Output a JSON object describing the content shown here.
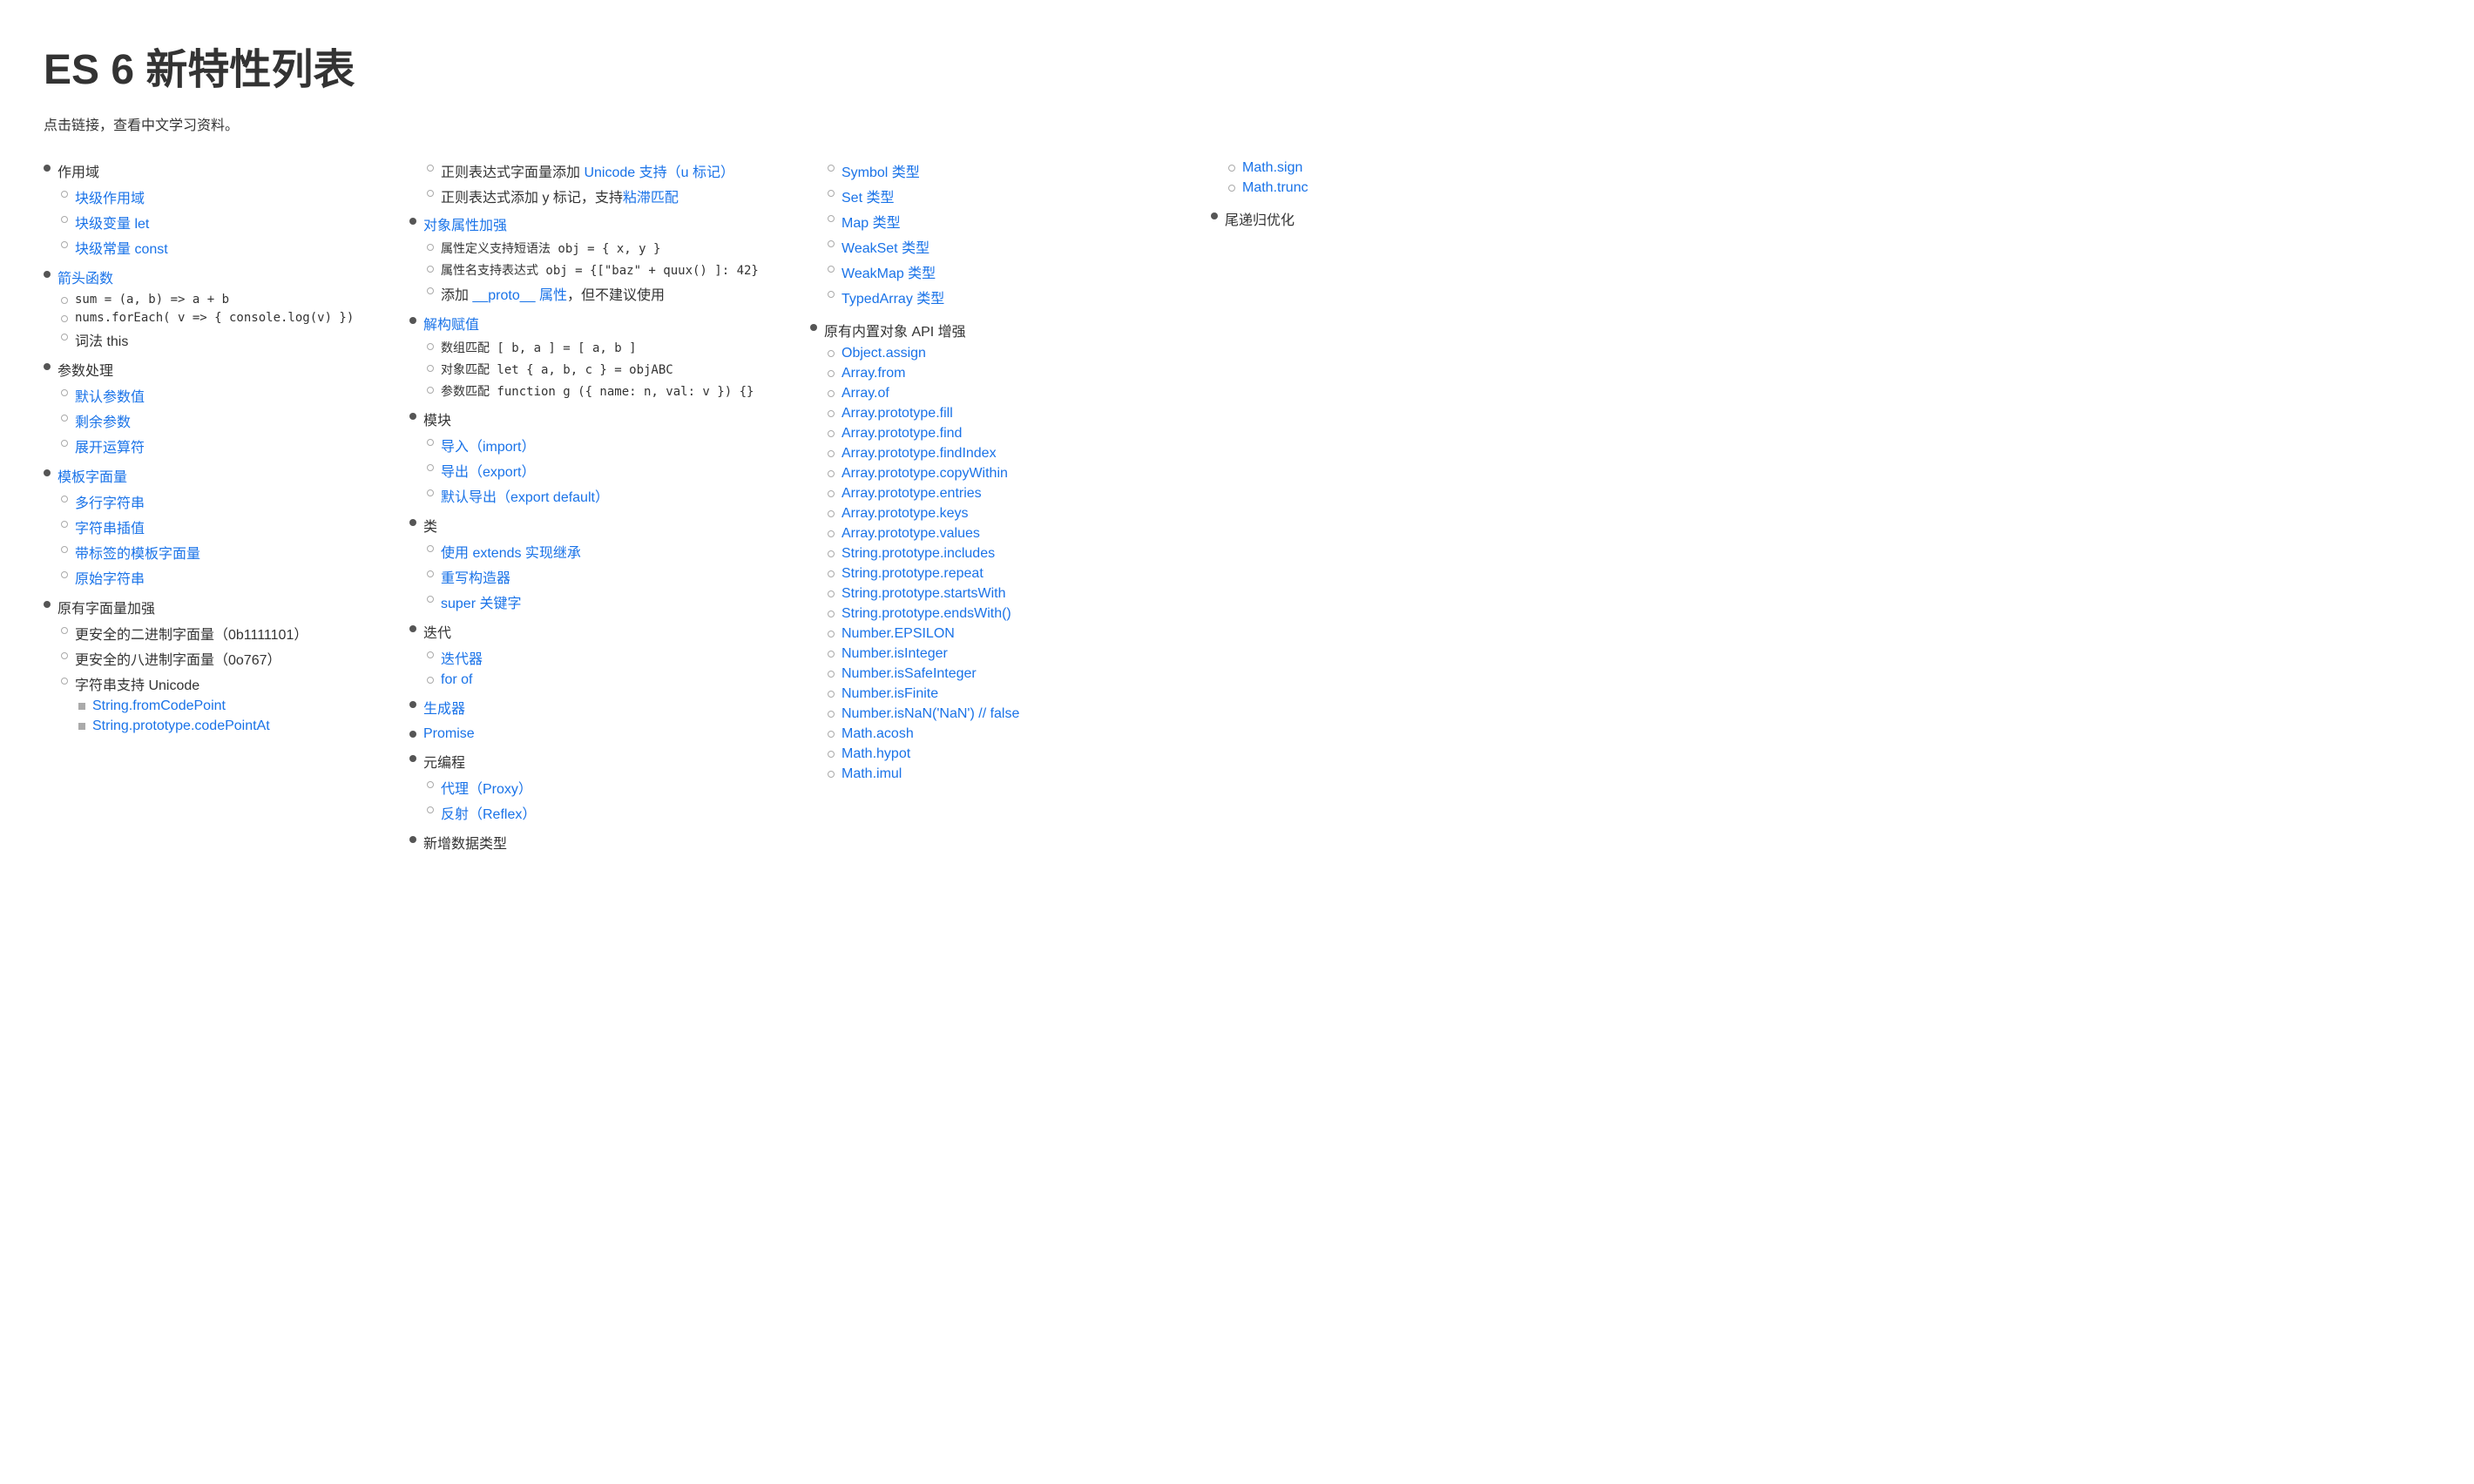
{
  "title": "ES 6 新特性列表",
  "subtitle": "点击链接，查看中文学习资料。",
  "col1": {
    "sections": [
      {
        "type": "top",
        "label": "作用域",
        "items": [
          {
            "label": "块级作用域",
            "link": true
          },
          {
            "label": "块级变量 let",
            "link": true
          },
          {
            "label": "块级常量 const",
            "link": true
          }
        ]
      },
      {
        "type": "top",
        "label": "箭头函数",
        "link": true,
        "items": [
          {
            "label": "sum = (a, b) => a + b",
            "code": true,
            "link": false
          },
          {
            "label": "nums.forEach( v => { console.log(v) })",
            "code": true,
            "link": false
          },
          {
            "label": "词法 this",
            "link": false
          }
        ]
      },
      {
        "type": "top",
        "label": "参数处理",
        "items": [
          {
            "label": "默认参数值",
            "link": true
          },
          {
            "label": "剩余参数",
            "link": true
          },
          {
            "label": "展开运算符",
            "link": true
          }
        ]
      },
      {
        "type": "top",
        "label": "模板字面量",
        "link": true,
        "items": [
          {
            "label": "多行字符串",
            "link": true
          },
          {
            "label": "字符串插值",
            "link": true
          },
          {
            "label": "带标签的模板字面量",
            "link": true
          },
          {
            "label": "原始字符串",
            "link": true
          }
        ]
      },
      {
        "type": "top",
        "label": "原有字面量加强",
        "items": [
          {
            "label": "更安全的二进制字面量（0b1111101）",
            "link": false
          },
          {
            "label": "更安全的八进制字面量（0o767）",
            "link": false
          },
          {
            "label": "字符串支持 Unicode",
            "link": false,
            "sub": [
              {
                "label": "String.fromCodePoint",
                "link": true
              },
              {
                "label": "String.prototype.codePointAt",
                "link": true
              }
            ]
          }
        ]
      }
    ]
  },
  "col2": {
    "sections": [
      {
        "type": "plain",
        "items": [
          {
            "label": "正则表达式字面量添加 Unicode 支持（u 标记）",
            "link_part": "Unicode 支持（u 标记）"
          },
          {
            "label": "正则表达式添加 y 标记，支持粘滞匹配",
            "link_part": "粘滞匹配"
          }
        ]
      },
      {
        "type": "top",
        "label": "对象属性加强",
        "link": true,
        "items": [
          {
            "label": "属性定义支持短语法 obj = { x, y }",
            "code": true
          },
          {
            "label": "属性名支持表达式 obj = {[\"baz\" + quux() ]: 42}",
            "code": true
          },
          {
            "label": "添加 __proto__ 属性，但不建议使用",
            "link_part": "__proto__ 属性"
          }
        ]
      },
      {
        "type": "top",
        "label": "解构赋值",
        "link": true,
        "items": [
          {
            "label": "数组匹配 [ b, a ] = [ a, b ]",
            "code": true
          },
          {
            "label": "对象匹配 let { a, b, c } = objABC",
            "code": true
          },
          {
            "label": "参数匹配 function g ({ name: n, val: v }) {}",
            "code": true
          }
        ]
      },
      {
        "type": "top",
        "label": "模块",
        "items": [
          {
            "label": "导入（import）",
            "link": true
          },
          {
            "label": "导出（export）",
            "link": true
          },
          {
            "label": "默认导出（export default）",
            "link": true
          }
        ]
      },
      {
        "type": "top",
        "label": "类",
        "items": [
          {
            "label": "使用 extends 实现继承",
            "link": true
          },
          {
            "label": "重写构造器",
            "link": true
          },
          {
            "label": "super 关键字",
            "link": true
          }
        ]
      },
      {
        "type": "top",
        "label": "迭代",
        "items": [
          {
            "label": "迭代器",
            "link": true
          },
          {
            "label": "for of",
            "link": true
          }
        ]
      },
      {
        "type": "top-single",
        "label": "生成器",
        "link": true
      },
      {
        "type": "top-single",
        "label": "Promise",
        "link": true
      },
      {
        "type": "top",
        "label": "元编程",
        "items": [
          {
            "label": "代理（Proxy）",
            "link": true
          },
          {
            "label": "反射（Reflex）",
            "link": true
          }
        ]
      },
      {
        "type": "top-single",
        "label": "新增数据类型",
        "link": false
      }
    ]
  },
  "col3": {
    "intro": "原有内置对象 API 增强",
    "items": [
      {
        "label": "Symbol 类型",
        "link": true
      },
      {
        "label": "Set 类型",
        "link": true
      },
      {
        "label": "Map 类型",
        "link": true
      },
      {
        "label": "WeakSet 类型",
        "link": true
      },
      {
        "label": "WeakMap 类型",
        "link": true
      },
      {
        "label": "TypedArray 类型",
        "link": true
      }
    ],
    "api_items": [
      {
        "label": "Object.assign",
        "link": true
      },
      {
        "label": "Array.from",
        "link": true
      },
      {
        "label": "Array.of",
        "link": true
      },
      {
        "label": "Array.prototype.fill",
        "link": true
      },
      {
        "label": "Array.prototype.find",
        "link": true
      },
      {
        "label": "Array.prototype.findIndex",
        "link": true
      },
      {
        "label": "Array.prototype.copyWithin",
        "link": true
      },
      {
        "label": "Array.prototype.entries",
        "link": true
      },
      {
        "label": "Array.prototype.keys",
        "link": true
      },
      {
        "label": "Array.prototype.values",
        "link": true
      },
      {
        "label": "String.prototype.includes",
        "link": true
      },
      {
        "label": "String.prototype.repeat",
        "link": true
      },
      {
        "label": "String.prototype.startsWith",
        "link": true
      },
      {
        "label": "String.prototype.endsWith()",
        "link": true
      },
      {
        "label": "Number.EPSILON",
        "link": true
      },
      {
        "label": "Number.isInteger",
        "link": true
      },
      {
        "label": "Number.isSafeInteger",
        "link": true
      },
      {
        "label": "Number.isFinite",
        "link": true
      },
      {
        "label": "Number.isNaN('NaN') // false",
        "link": true
      },
      {
        "label": "Math.acosh",
        "link": true
      },
      {
        "label": "Math.hypot",
        "link": true
      },
      {
        "label": "Math.imul",
        "link": true
      }
    ]
  },
  "col4": {
    "items": [
      {
        "label": "Math.sign",
        "link": true
      },
      {
        "label": "Math.trunc",
        "link": true
      }
    ],
    "tail": [
      {
        "label": "尾递归优化",
        "link": false
      }
    ]
  }
}
